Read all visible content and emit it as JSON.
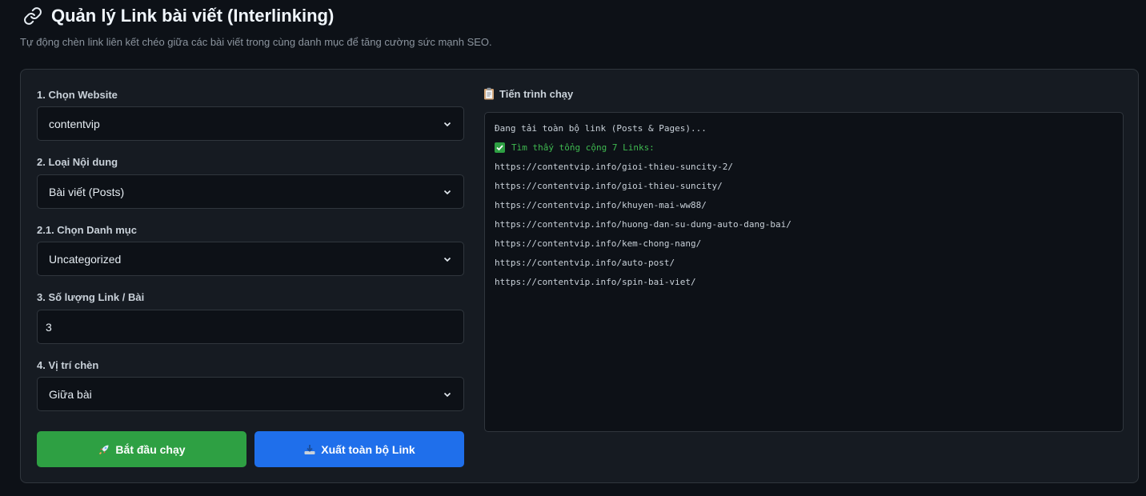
{
  "header": {
    "title": "Quản lý Link bài viết (Interlinking)",
    "subtitle": "Tự động chèn link liên kết chéo giữa các bài viết trong cùng danh mục để tăng cường sức mạnh SEO.",
    "icon": "link-icon"
  },
  "form": {
    "website": {
      "label": "1. Chọn Website",
      "value": "contentvip"
    },
    "content_type": {
      "label": "2. Loại Nội dung",
      "value": "Bài viết (Posts)"
    },
    "category": {
      "label": "2.1. Chọn Danh mục",
      "value": "Uncategorized"
    },
    "link_count": {
      "label": "3. Số lượng Link / Bài",
      "value": "3"
    },
    "position": {
      "label": "4. Vị trí chèn",
      "value": "Giữa bài"
    }
  },
  "buttons": {
    "start": {
      "label": "Bắt đầu chạy",
      "icon": "rocket-icon",
      "color": "#2ea043"
    },
    "export": {
      "label": "Xuất toàn bộ Link",
      "icon": "download-icon",
      "color": "#1f6feb"
    }
  },
  "log": {
    "title": "Tiến trình chạy",
    "icon": "clipboard-icon",
    "loading_line": "Đang tải toàn bộ link (Posts & Pages)...",
    "found_line": "Tìm thấy tổng cộng 7 Links:",
    "links": [
      "https://contentvip.info/gioi-thieu-suncity-2/",
      "https://contentvip.info/gioi-thieu-suncity/",
      "https://contentvip.info/khuyen-mai-ww88/",
      "https://contentvip.info/huong-dan-su-dung-auto-dang-bai/",
      "https://contentvip.info/kem-chong-nang/",
      "https://contentvip.info/auto-post/",
      "https://contentvip.info/spin-bai-viet/"
    ]
  },
  "colors": {
    "background": "#0d1117",
    "panel": "#161b22",
    "success_text": "#3fb950"
  }
}
